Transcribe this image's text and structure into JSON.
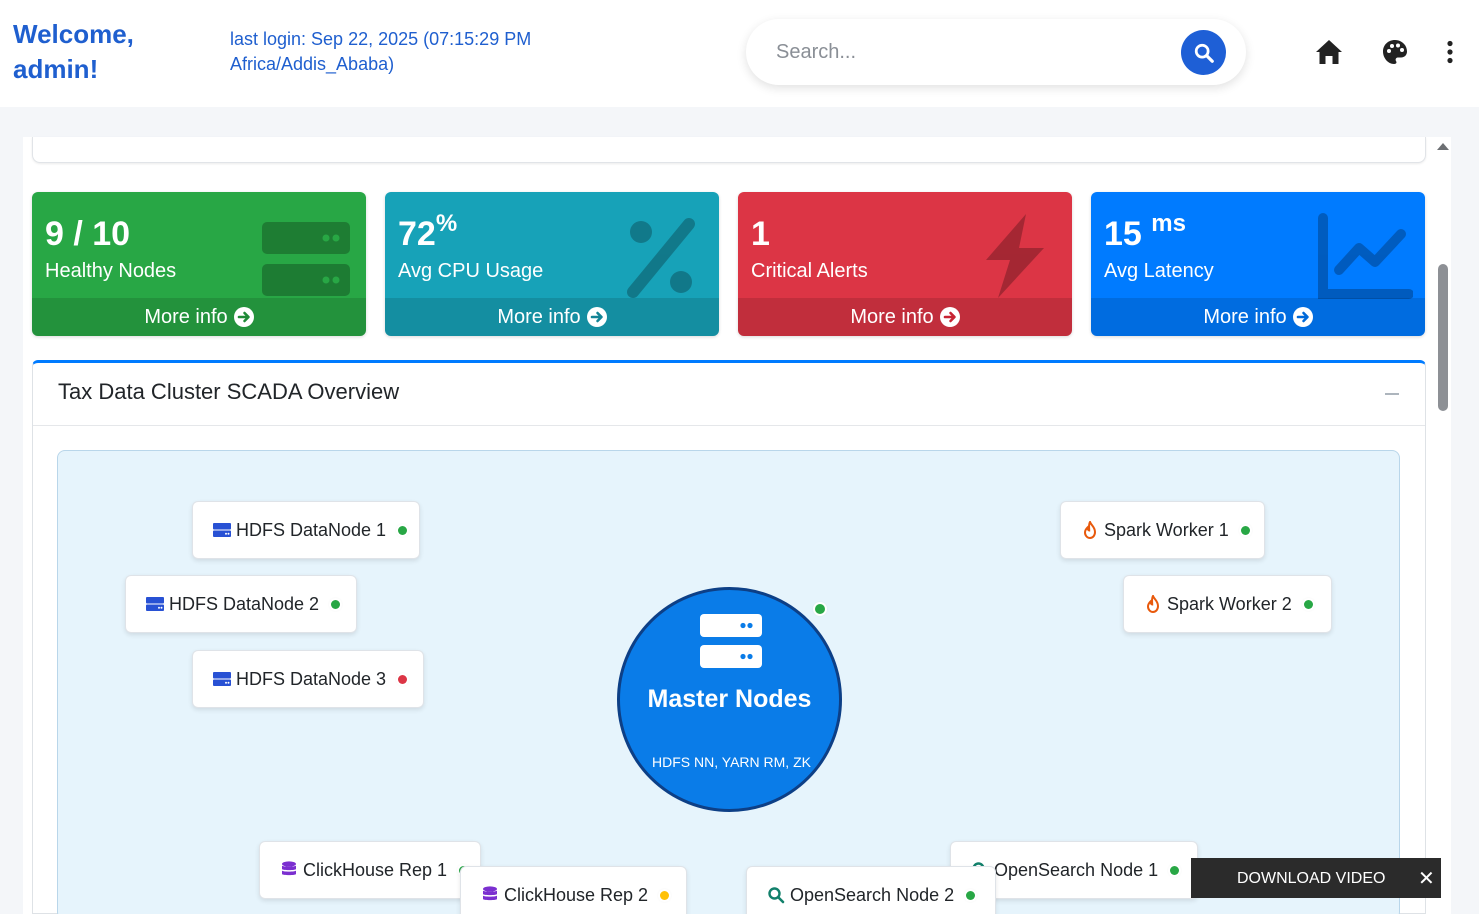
{
  "header": {
    "welcome": "Welcome, admin!",
    "last_login": "last login: Sep 22, 2025 (07:15:29 PM Africa/Addis_Ababa)",
    "search_placeholder": "Search..."
  },
  "small_boxes": [
    {
      "value": "9 / 10",
      "unit": "",
      "label": "Healthy Nodes",
      "footer": "More info",
      "color": "#28a745",
      "icon": "server-icon"
    },
    {
      "value": "72",
      "unit": "%",
      "label": "Avg CPU Usage",
      "footer": "More info",
      "color": "#17a2b8",
      "icon": "percent-icon"
    },
    {
      "value": "1",
      "unit": "",
      "label": "Critical Alerts",
      "footer": "More info",
      "color": "#dc3545",
      "icon": "bolt-icon"
    },
    {
      "value": "15",
      "unit": "ms",
      "label": "Avg Latency",
      "footer": "More info",
      "color": "#007bff",
      "icon": "chart-line-icon"
    }
  ],
  "overview": {
    "title": "Tax Data Cluster SCADA Overview",
    "master": {
      "title": "Master Nodes",
      "subtitle": "HDFS NN, YARN RM, ZK",
      "status": "ok"
    },
    "nodes": [
      {
        "label": "HDFS DataNode 1",
        "type": "hdfs",
        "status": "ok"
      },
      {
        "label": "HDFS DataNode 2",
        "type": "hdfs",
        "status": "ok"
      },
      {
        "label": "HDFS DataNode 3",
        "type": "hdfs",
        "status": "error"
      },
      {
        "label": "Spark Worker 1",
        "type": "spark",
        "status": "ok"
      },
      {
        "label": "Spark Worker 2",
        "type": "spark",
        "status": "ok"
      },
      {
        "label": "ClickHouse Rep 1",
        "type": "clickhouse",
        "status": "ok"
      },
      {
        "label": "ClickHouse Rep 2",
        "type": "clickhouse",
        "status": "warning"
      },
      {
        "label": "OpenSearch Node 1",
        "type": "opensearch",
        "status": "ok"
      },
      {
        "label": "OpenSearch Node 2",
        "type": "opensearch",
        "status": "ok"
      }
    ],
    "status_colors": {
      "ok": "#28a745",
      "warning": "#ffc107",
      "error": "#dc3545"
    }
  },
  "download_bar": {
    "label": "DOWNLOAD VIDEO",
    "close": "✕"
  }
}
